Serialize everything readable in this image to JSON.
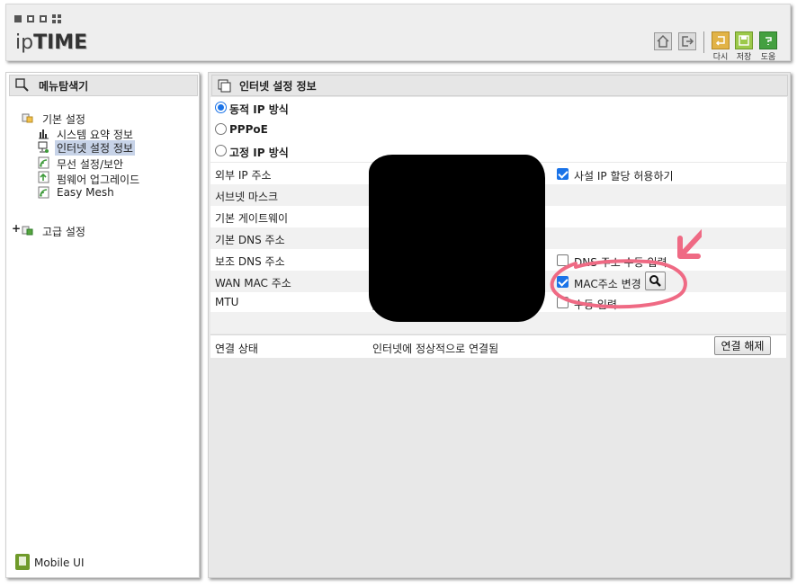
{
  "header": {
    "brand_prefix": "ip",
    "brand_bold": "TIME",
    "buttons": [
      {
        "name": "home",
        "icon": "home-icon"
      },
      {
        "name": "logout",
        "icon": "logout-icon"
      },
      {
        "name": "reload",
        "icon": "reload-icon",
        "label": "다시"
      },
      {
        "name": "save",
        "icon": "save-icon",
        "label": "저장"
      },
      {
        "name": "help",
        "icon": "help-icon",
        "label": "도움"
      }
    ],
    "colors": {
      "reload": "#d7a437",
      "save": "#8fbf3a",
      "help": "#3e9a3a"
    }
  },
  "sidebar": {
    "title": "메뉴탐색기",
    "basic_group": "기본 설정",
    "basic_items": [
      "시스템 요약 정보",
      "인터넷 설정 정보",
      "무선 설정/보안",
      "펌웨어 업그레이드",
      "Easy Mesh"
    ],
    "advanced_expander": "+",
    "advanced_group": "고급 설정",
    "mobile_ui": "Mobile UI"
  },
  "main": {
    "title": "인터넷 설정 정보",
    "connection_modes": [
      "동적 IP 방식",
      "PPPoE",
      "고정 IP 방식"
    ],
    "selected_mode": "동적 IP 방식",
    "fields": [
      "외부 IP 주소",
      "서브넷 마스크",
      "기본 게이트웨이",
      "기본 DNS 주소",
      "보조 DNS 주소",
      "WAN MAC 주소",
      "MTU"
    ],
    "options": {
      "private_ip": {
        "label": "사설 IP 할당 허용하기",
        "checked": true
      },
      "dns_manual": {
        "label": "DNS 주소 수동 입력",
        "checked": false
      },
      "mac_change": {
        "label": "MAC주소 변경",
        "checked": true
      },
      "mtu_manual": {
        "label": "수동 입력",
        "checked": false
      }
    },
    "status_label": "연결 상태",
    "status_value": "인터넷에 정상적으로 연결됨",
    "disconnect_button": "연결 해제"
  },
  "annotation_color": "#ef6a84"
}
